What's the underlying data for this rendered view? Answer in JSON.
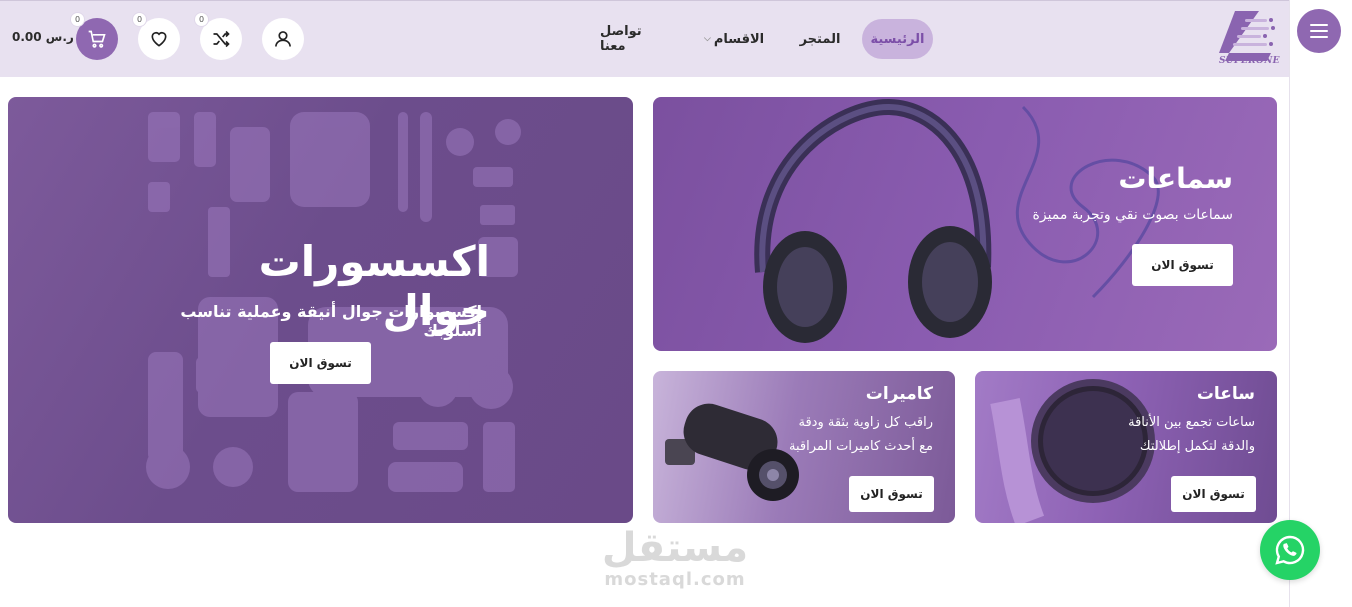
{
  "header": {
    "logo_text": "SUPERONE",
    "nav": {
      "home": "الرئيسية",
      "store": "المتجر",
      "categories": "الاقسام",
      "contact": "تواصل معنا"
    },
    "counts": {
      "compare": "0",
      "wishlist": "0",
      "cart": "0"
    },
    "cart_total": "0.00 ر.س"
  },
  "banners": {
    "accessories": {
      "title": "اكسسورات جوال",
      "subtitle": "إكسسوارات جوال أنيقة وعملية تناسب أسلوبك",
      "button": "تسوق الان"
    },
    "headphones": {
      "title": "سماعات",
      "subtitle": "سماعات بصوت نقي وتجربة مميزة",
      "button": "تسوق الان"
    },
    "cameras": {
      "title": "كاميرات",
      "subtitle_line1": "راقب كل زاوية بثقة ودقة",
      "subtitle_line2": "مع أحدث كاميرات المراقبة",
      "button": "تسوق الان"
    },
    "watches": {
      "title": "ساعات",
      "subtitle_line1": "ساعات تجمع بين الأناقة",
      "subtitle_line2": "والدقة لتكمل إطلالتك",
      "button": "تسوق الان"
    }
  },
  "watermark": {
    "arabic": "مستقل",
    "latin": "mostaql.com"
  },
  "colors": {
    "accent": "#8f68b1",
    "header_bg": "#e8e1f0",
    "whatsapp": "#25d366"
  },
  "icons": [
    "menu-icon",
    "user-icon",
    "shuffle-icon",
    "heart-icon",
    "cart-icon",
    "whatsapp-icon",
    "chevron-down-icon"
  ]
}
